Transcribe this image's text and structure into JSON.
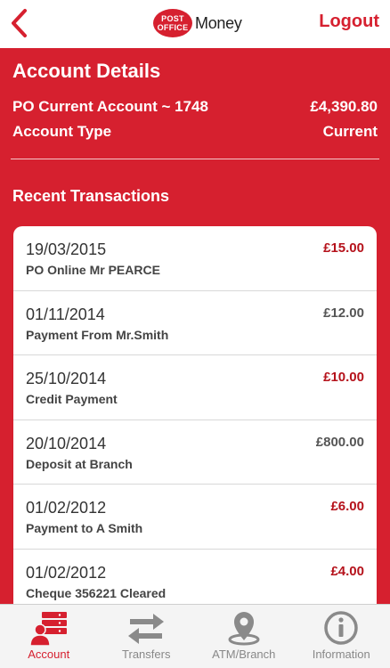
{
  "header": {
    "logo_line1": "POST",
    "logo_line2": "OFFICE",
    "logo_word": "Money",
    "logout_label": "Logout"
  },
  "account": {
    "title": "Account Details",
    "name_label": "PO Current Account ~ 1748",
    "balance": "£4,390.80",
    "type_label": "Account Type",
    "type_value": "Current"
  },
  "recent_title": "Recent Transactions",
  "transactions": [
    {
      "date": "19/03/2015",
      "desc": "PO Online Mr PEARCE",
      "amount": "£15.00"
    },
    {
      "date": "01/11/2014",
      "desc": "Payment From Mr.Smith",
      "amount": "£12.00"
    },
    {
      "date": "25/10/2014",
      "desc": "Credit Payment",
      "amount": "£10.00"
    },
    {
      "date": "20/10/2014",
      "desc": "Deposit at Branch",
      "amount": "£800.00"
    },
    {
      "date": "01/02/2012",
      "desc": "Payment to A Smith",
      "amount": "£6.00"
    },
    {
      "date": "01/02/2012",
      "desc": "Cheque 356221 Cleared",
      "amount": "£4.00"
    }
  ],
  "tabs": [
    {
      "label": "Account",
      "icon": "account-icon"
    },
    {
      "label": "Transfers",
      "icon": "transfers-icon"
    },
    {
      "label": "ATM/Branch",
      "icon": "map-pin-icon"
    },
    {
      "label": "Information",
      "icon": "info-icon"
    }
  ],
  "colors": {
    "brand_red": "#d6202f",
    "debit_red": "#b5121b",
    "credit_grey": "#555555"
  }
}
